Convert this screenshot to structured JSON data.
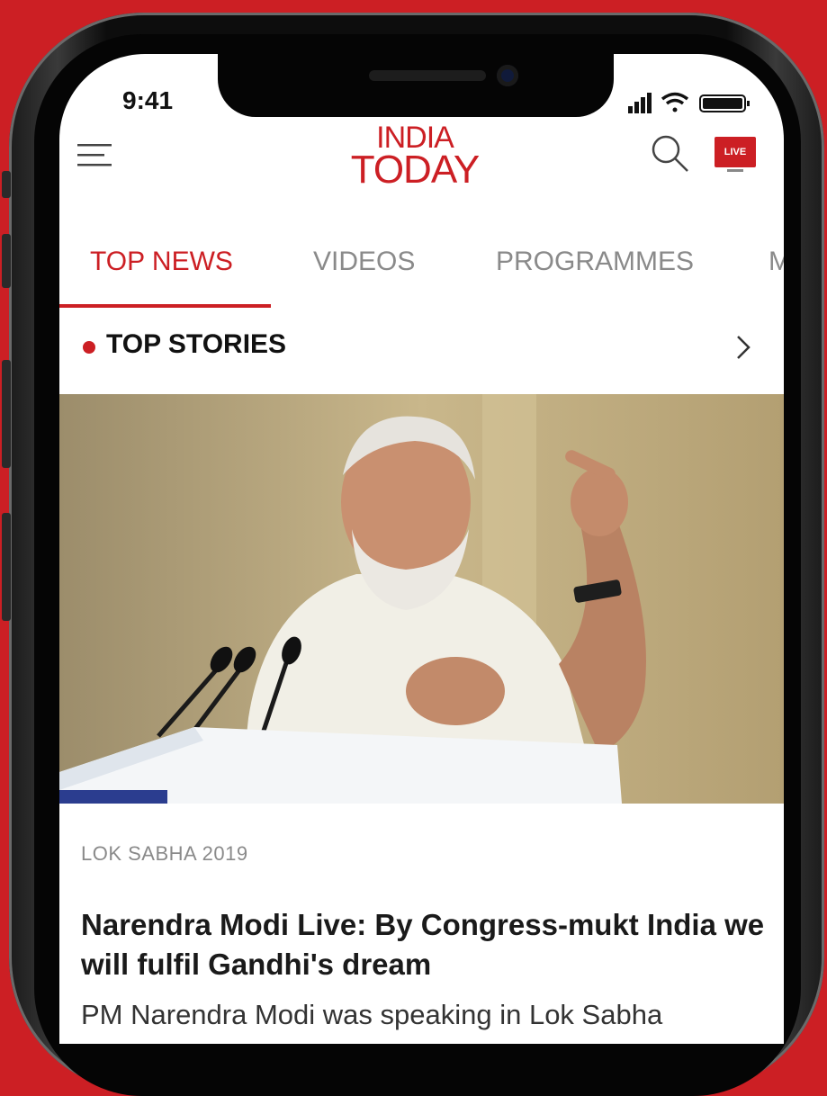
{
  "colors": {
    "accent": "#cc1f24",
    "background": "#cc1f24"
  },
  "status_bar": {
    "time": "9:41"
  },
  "header": {
    "logo_line1": "INDIA",
    "logo_line2": "TODAY",
    "live_label": "LIVE"
  },
  "tabs": [
    {
      "label": "TOP NEWS"
    },
    {
      "label": "VIDEOS"
    },
    {
      "label": "PROGRAMMES"
    },
    {
      "label": "M"
    }
  ],
  "section": {
    "title": "TOP STORIES"
  },
  "article": {
    "category": "LOK SABHA 2019",
    "headline": "Narendra Modi Live: By Congress-mukt India we will fulfil Gandhi's dream",
    "summary": "PM Narendra Modi was speaking in Lok Sabha"
  },
  "icons": [
    "menu-icon",
    "search-icon",
    "live-tv-icon",
    "chevron-right-icon",
    "signal-icon",
    "wifi-icon",
    "battery-icon"
  ]
}
